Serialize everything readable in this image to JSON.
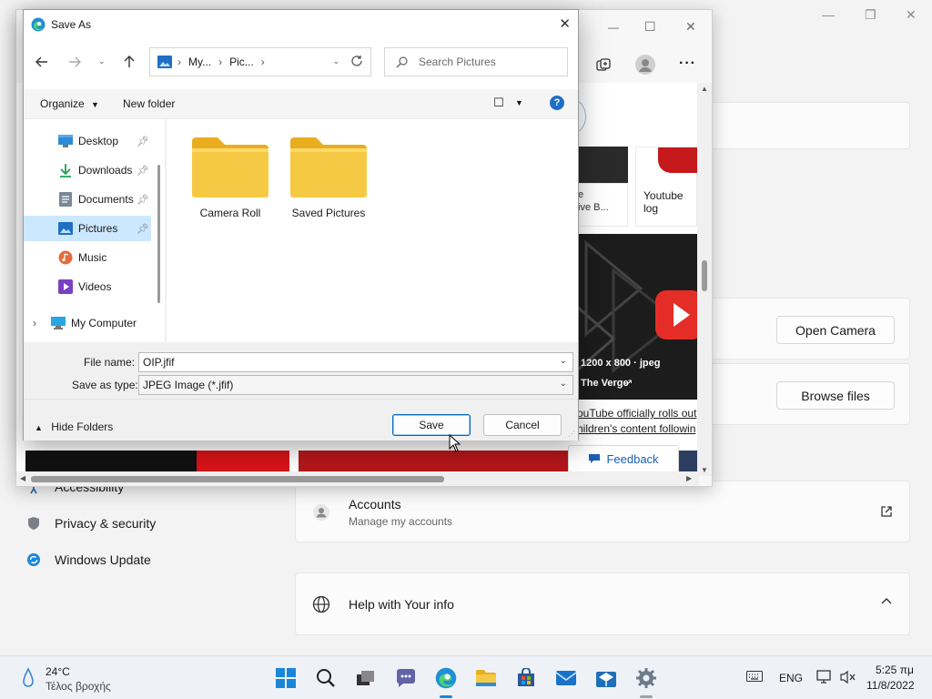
{
  "settings": {
    "left_items": [
      {
        "label": "Accessibility",
        "icon": "accessibility-icon"
      },
      {
        "label": "Privacy & security",
        "icon": "shield-icon"
      },
      {
        "label": "Windows Update",
        "icon": "windows-update-icon"
      }
    ],
    "open_camera_label": "Open Camera",
    "browse_files_label": "Browse files",
    "accounts_title": "Accounts",
    "accounts_subtitle": "Manage my accounts",
    "help_title": "Help with Your info"
  },
  "edge": {
    "card1_text_a": "e",
    "card1_text_b": "ive B...",
    "card2_text": "Youtube log",
    "image_dims": "1200 x 800 · jpeg",
    "source": "The Verge",
    "article_line1": "ouTube officially rolls out",
    "article_line2": "hildren's content followin",
    "feedback_label": "Feedback"
  },
  "dialog": {
    "title": "Save As",
    "breadcrumb": [
      "My...",
      "Pic..."
    ],
    "search_placeholder": "Search Pictures",
    "organize_label": "Organize",
    "new_folder_label": "New folder",
    "tree": [
      {
        "label": "Desktop",
        "icon": "desktop-icon",
        "pinned": true
      },
      {
        "label": "Downloads",
        "icon": "downloads-icon",
        "pinned": true
      },
      {
        "label": "Documents",
        "icon": "documents-icon",
        "pinned": true
      },
      {
        "label": "Pictures",
        "icon": "pictures-icon",
        "pinned": true
      },
      {
        "label": "Music",
        "icon": "music-icon",
        "pinned": false
      },
      {
        "label": "Videos",
        "icon": "videos-icon",
        "pinned": false
      },
      {
        "label": "My Computer",
        "icon": "computer-icon",
        "pinned": false
      }
    ],
    "folders": [
      "Camera Roll",
      "Saved Pictures"
    ],
    "file_name_label": "File name:",
    "file_name_value": "OIP.jfif",
    "save_type_label": "Save as type:",
    "save_type_value": "JPEG Image (*.jfif)",
    "hide_folders_label": "Hide Folders",
    "save_label": "Save",
    "cancel_label": "Cancel"
  },
  "taskbar": {
    "temperature": "24°C",
    "weather": "Τέλος βροχής",
    "language": "ENG",
    "time": "5:25 πμ",
    "date": "11/8/2022"
  },
  "colors": {
    "selection": "#cce8ff",
    "accent": "#0067c0",
    "folder": "#f6c945",
    "youtube_red": "#e52d27"
  }
}
